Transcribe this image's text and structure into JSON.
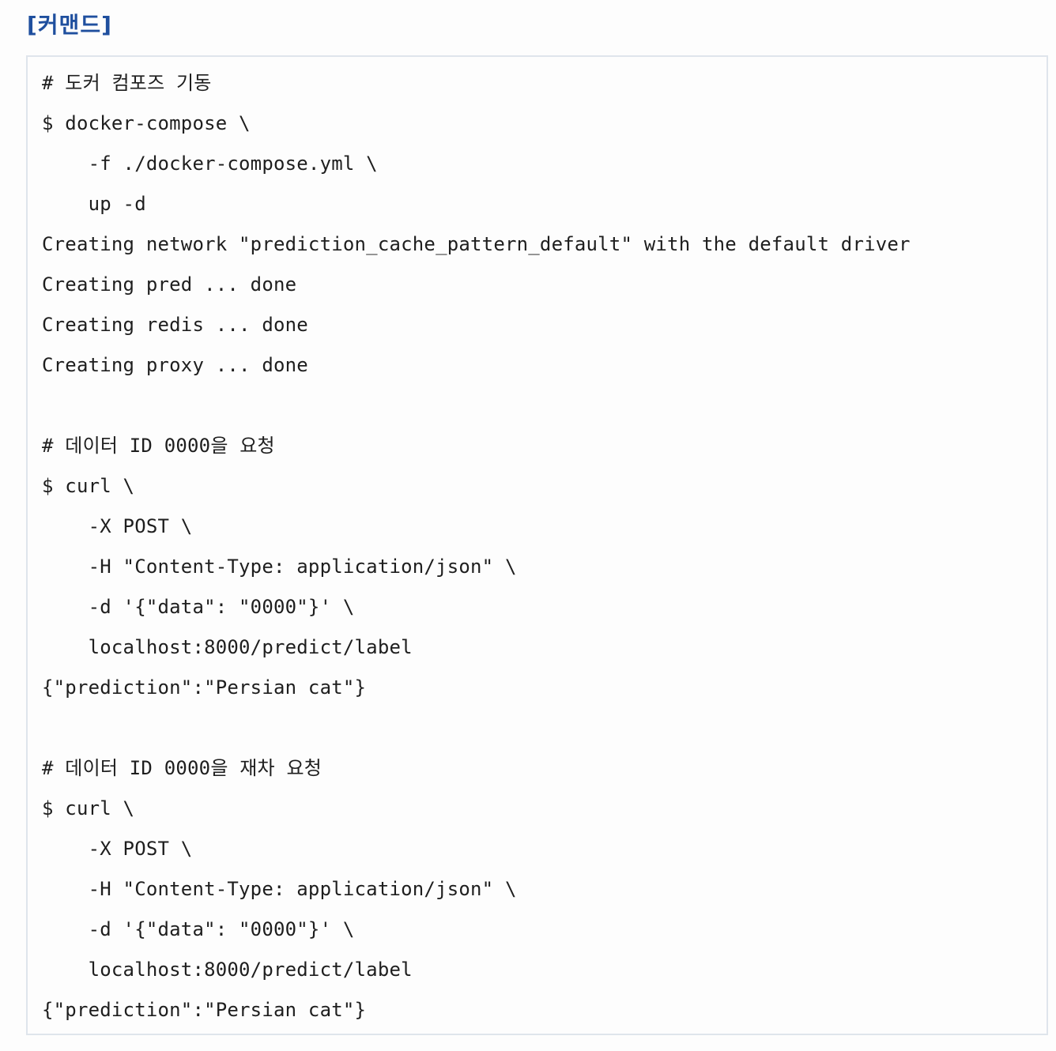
{
  "colors": {
    "heading": "#1f4f9e",
    "code_text": "#1e1e1e",
    "box_border": "#dfe5ec",
    "background": "#fdfdfd"
  },
  "heading": "[커맨드]",
  "code_lines": [
    "# 도커 컴포즈 기동",
    "$ docker-compose \\",
    "    -f ./docker-compose.yml \\",
    "    up -d",
    "Creating network \"prediction_cache_pattern_default\" with the default driver",
    "Creating pred ... done",
    "Creating redis ... done",
    "Creating proxy ... done",
    "",
    "# 데이터 ID 0000을 요청",
    "$ curl \\",
    "    -X POST \\",
    "    -H \"Content-Type: application/json\" \\",
    "    -d '{\"data\": \"0000\"}' \\",
    "    localhost:8000/predict/label",
    "{\"prediction\":\"Persian cat\"}",
    "",
    "# 데이터 ID 0000을 재차 요청",
    "$ curl \\",
    "    -X POST \\",
    "    -H \"Content-Type: application/json\" \\",
    "    -d '{\"data\": \"0000\"}' \\",
    "    localhost:8000/predict/label",
    "{\"prediction\":\"Persian cat\"}"
  ]
}
